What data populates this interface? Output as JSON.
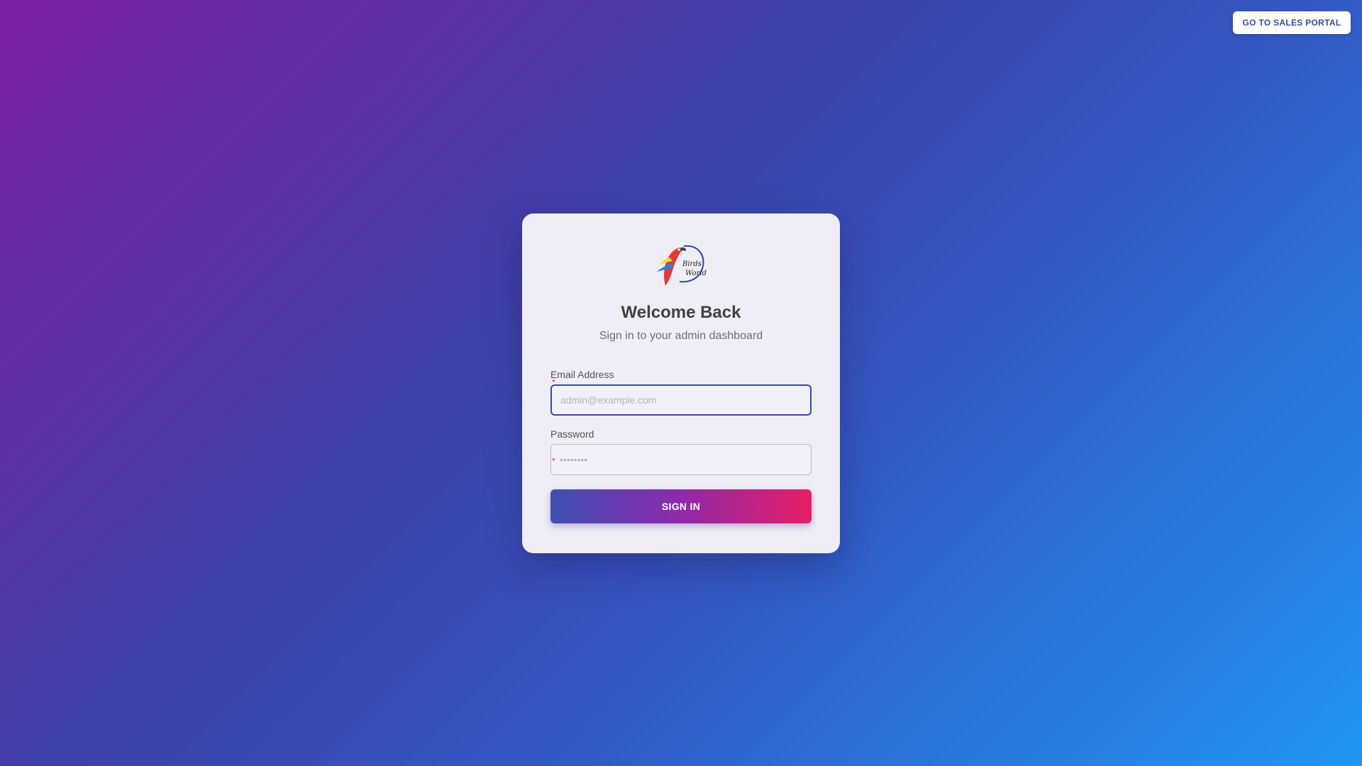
{
  "header": {
    "portal_button_label": "GO TO SALES PORTAL"
  },
  "login_card": {
    "logo": {
      "icon": "parrot-logo",
      "text_line1": "Birds",
      "text_line2": "World"
    },
    "title": "Welcome Back",
    "subtitle": "Sign in to your admin dashboard",
    "email": {
      "label": "Email Address",
      "required_mark": "*",
      "value": "",
      "placeholder": "admin@example.com"
    },
    "password": {
      "label": "Password",
      "required_mark": "*",
      "value": "",
      "placeholder": "••••••••"
    },
    "submit_label": "SIGN IN"
  },
  "colors": {
    "accent": "#3949ab",
    "required": "#e53935",
    "button_gradient_start": "#3f51b5",
    "button_gradient_end": "#e91e63"
  }
}
